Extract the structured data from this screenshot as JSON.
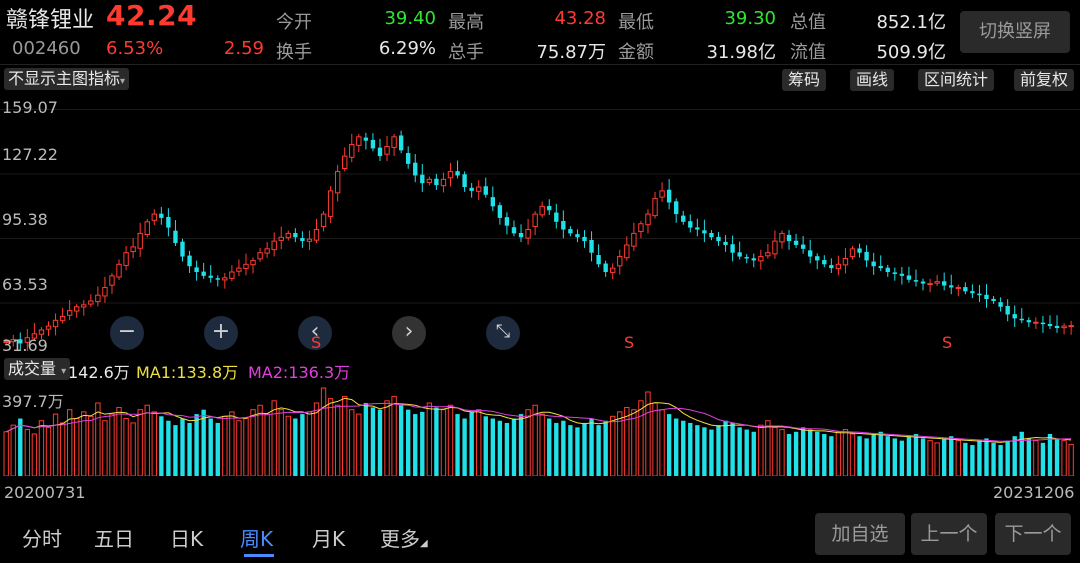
{
  "header": {
    "stock_name": "赣锋锂业",
    "price": "42.24",
    "code": "002460",
    "change_pct": "6.53%",
    "change_amt": "2.59",
    "quote": {
      "open_label": "今开",
      "open": "39.40",
      "high_label": "最高",
      "high": "43.28",
      "low_label": "最低",
      "low": "39.30",
      "total_cap_label": "总值",
      "total_cap": "852.1亿",
      "turnover_label": "换手",
      "turnover": "6.29%",
      "volume_label": "总手",
      "volume": "75.87万",
      "amount_label": "金额",
      "amount": "31.98亿",
      "float_cap_label": "流值",
      "float_cap": "509.9亿"
    },
    "switch_label": "切换竖屏"
  },
  "toolbar": {
    "indicator_select": "不显示主图指标",
    "chip_label": "筹码",
    "draw_label": "画线",
    "range_stats_label": "区间统计",
    "adjust_label": "前复权"
  },
  "price_axis": {
    "labels": [
      "159.07",
      "127.22",
      "95.38",
      "63.53",
      "31.69"
    ]
  },
  "controls": {
    "zoom_out": "−",
    "zoom_in": "+",
    "prev": "‹",
    "next": "›",
    "shrink": "⤡"
  },
  "signals": [
    "S",
    "S",
    "S",
    "S"
  ],
  "volume_panel": {
    "selector_label": "成交量",
    "value": "142.6万",
    "ma1": "MA1:133.8万",
    "ma2": "MA2:136.3万",
    "axis_max": "397.7万"
  },
  "dates": {
    "start": "20200731",
    "end": "20231206"
  },
  "tabs": [
    {
      "label": "分时"
    },
    {
      "label": "五日"
    },
    {
      "label": "日K"
    },
    {
      "label": "周K"
    },
    {
      "label": "月K"
    },
    {
      "label": "更多"
    }
  ],
  "active_tab": "周K",
  "buttons": {
    "add_watch": "加自选",
    "prev_stock": "上一个",
    "next_stock": "下一个"
  },
  "chart_data": {
    "type": "candlestick",
    "y_range": [
      31.69,
      159.07
    ],
    "up_color": "#ff3b30",
    "down_color": "#20e0e8",
    "ma1_color": "#f0e040",
    "ma2_color": "#e040e0",
    "closes": [
      34,
      35,
      33,
      36,
      38,
      40,
      42,
      45,
      47,
      50,
      52,
      53,
      55,
      58,
      62,
      68,
      74,
      80,
      83,
      90,
      96,
      100,
      98,
      93,
      85,
      78,
      73,
      70,
      68,
      67,
      66,
      67,
      70,
      72,
      74,
      76,
      80,
      82,
      86,
      88,
      90,
      88,
      86,
      87,
      92,
      100,
      112,
      122,
      130,
      136,
      140,
      138,
      134,
      130,
      135,
      140,
      133,
      126,
      120,
      116,
      118,
      115,
      118,
      122,
      120,
      114,
      112,
      114,
      110,
      104,
      98,
      94,
      90,
      88,
      92,
      100,
      104,
      102,
      96,
      92,
      90,
      88,
      86,
      80,
      74,
      70,
      72,
      78,
      84,
      90,
      95,
      100,
      108,
      112,
      106,
      100,
      96,
      93,
      92,
      90,
      88,
      86,
      84,
      80,
      78,
      77,
      76,
      78,
      80,
      86,
      90,
      86,
      84,
      82,
      78,
      76,
      74,
      72,
      74,
      77,
      82,
      80,
      76,
      73,
      72,
      70,
      69,
      68,
      66,
      65,
      64,
      64,
      65,
      63,
      62,
      62,
      60,
      59,
      58,
      56,
      55,
      52,
      48,
      46,
      45,
      44,
      44,
      43,
      42,
      41,
      42,
      42.24
    ],
    "volumes": [
      200,
      230,
      260,
      210,
      190,
      250,
      220,
      280,
      240,
      300,
      260,
      290,
      270,
      330,
      250,
      280,
      310,
      260,
      240,
      300,
      320,
      290,
      270,
      250,
      230,
      260,
      240,
      280,
      300,
      260,
      240,
      270,
      290,
      250,
      260,
      300,
      320,
      280,
      340,
      300,
      270,
      260,
      280,
      290,
      330,
      398,
      350,
      320,
      360,
      300,
      280,
      330,
      310,
      300,
      340,
      360,
      320,
      300,
      280,
      290,
      330,
      310,
      300,
      320,
      280,
      260,
      290,
      300,
      270,
      260,
      250,
      240,
      260,
      280,
      300,
      320,
      280,
      260,
      240,
      250,
      230,
      220,
      240,
      260,
      230,
      250,
      270,
      290,
      310,
      300,
      340,
      380,
      330,
      300,
      280,
      260,
      250,
      240,
      230,
      220,
      210,
      230,
      250,
      240,
      220,
      210,
      200,
      230,
      250,
      220,
      210,
      190,
      200,
      220,
      210,
      200,
      190,
      180,
      200,
      210,
      190,
      180,
      170,
      190,
      200,
      180,
      170,
      160,
      180,
      190,
      170,
      160,
      150,
      170,
      180,
      160,
      150,
      140,
      160,
      170,
      150,
      140,
      160,
      180,
      200,
      170,
      160,
      150,
      190,
      170,
      160,
      143
    ]
  }
}
